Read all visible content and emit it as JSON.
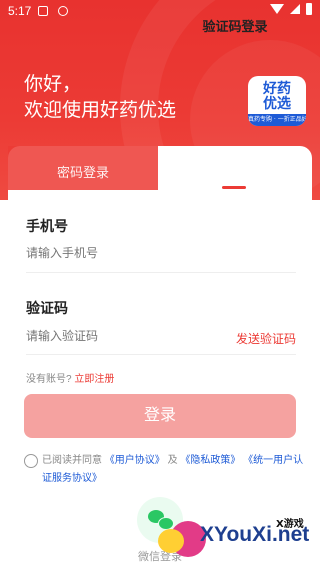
{
  "status_bar": {
    "time": "5:17"
  },
  "header": {
    "greeting_line1": "你好，",
    "greeting_line2": "欢迎使用好药优选",
    "logo_line1": "好药",
    "logo_line2": "优选",
    "logo_sub": "真药专购 · 一折正品好药",
    "brand_red": "#ec3b35",
    "brand_blue": "#1e5bd6"
  },
  "tabs": {
    "password_login": "密码登录",
    "sms_login": "验证码登录"
  },
  "form": {
    "phone_label": "手机号",
    "phone_placeholder": "请输入手机号",
    "code_label": "验证码",
    "code_placeholder": "请输入验证码",
    "send_code": "发送验证码",
    "no_account": "没有账号?",
    "register": "立即注册",
    "login_button": "登录"
  },
  "agreement": {
    "prefix": "已阅读并同意",
    "user_agreement": "《用户协议》",
    "and": "及",
    "privacy_policy": "《隐私政策》",
    "auth_agreement": "《统一用户认证服务协议》"
  },
  "third_party": {
    "wechat_label": "微信登录"
  },
  "watermark": {
    "caption": "X游戏",
    "text": "XYouXi.net"
  }
}
